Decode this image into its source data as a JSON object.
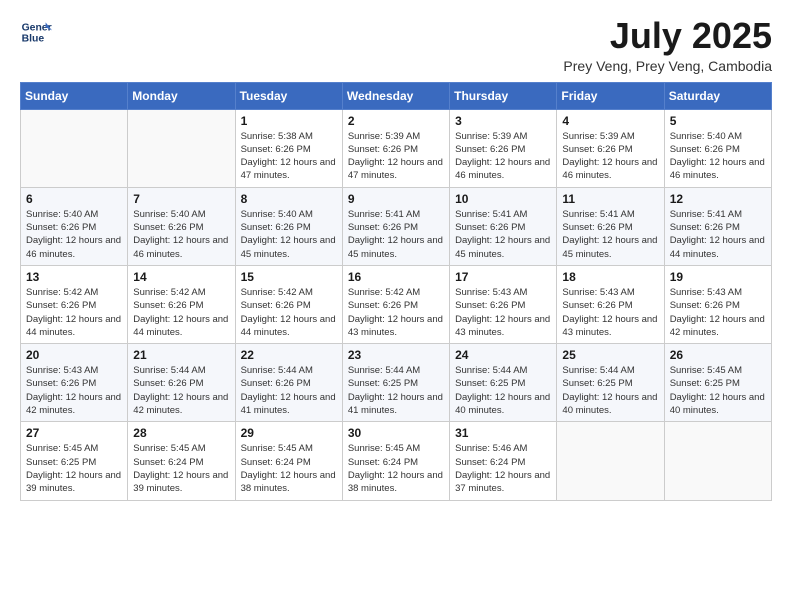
{
  "logo": {
    "line1": "General",
    "line2": "Blue"
  },
  "title": "July 2025",
  "location": "Prey Veng, Prey Veng, Cambodia",
  "days_of_week": [
    "Sunday",
    "Monday",
    "Tuesday",
    "Wednesday",
    "Thursday",
    "Friday",
    "Saturday"
  ],
  "weeks": [
    [
      {
        "day": "",
        "info": ""
      },
      {
        "day": "",
        "info": ""
      },
      {
        "day": "1",
        "info": "Sunrise: 5:38 AM\nSunset: 6:26 PM\nDaylight: 12 hours and 47 minutes."
      },
      {
        "day": "2",
        "info": "Sunrise: 5:39 AM\nSunset: 6:26 PM\nDaylight: 12 hours and 47 minutes."
      },
      {
        "day": "3",
        "info": "Sunrise: 5:39 AM\nSunset: 6:26 PM\nDaylight: 12 hours and 46 minutes."
      },
      {
        "day": "4",
        "info": "Sunrise: 5:39 AM\nSunset: 6:26 PM\nDaylight: 12 hours and 46 minutes."
      },
      {
        "day": "5",
        "info": "Sunrise: 5:40 AM\nSunset: 6:26 PM\nDaylight: 12 hours and 46 minutes."
      }
    ],
    [
      {
        "day": "6",
        "info": "Sunrise: 5:40 AM\nSunset: 6:26 PM\nDaylight: 12 hours and 46 minutes."
      },
      {
        "day": "7",
        "info": "Sunrise: 5:40 AM\nSunset: 6:26 PM\nDaylight: 12 hours and 46 minutes."
      },
      {
        "day": "8",
        "info": "Sunrise: 5:40 AM\nSunset: 6:26 PM\nDaylight: 12 hours and 45 minutes."
      },
      {
        "day": "9",
        "info": "Sunrise: 5:41 AM\nSunset: 6:26 PM\nDaylight: 12 hours and 45 minutes."
      },
      {
        "day": "10",
        "info": "Sunrise: 5:41 AM\nSunset: 6:26 PM\nDaylight: 12 hours and 45 minutes."
      },
      {
        "day": "11",
        "info": "Sunrise: 5:41 AM\nSunset: 6:26 PM\nDaylight: 12 hours and 45 minutes."
      },
      {
        "day": "12",
        "info": "Sunrise: 5:41 AM\nSunset: 6:26 PM\nDaylight: 12 hours and 44 minutes."
      }
    ],
    [
      {
        "day": "13",
        "info": "Sunrise: 5:42 AM\nSunset: 6:26 PM\nDaylight: 12 hours and 44 minutes."
      },
      {
        "day": "14",
        "info": "Sunrise: 5:42 AM\nSunset: 6:26 PM\nDaylight: 12 hours and 44 minutes."
      },
      {
        "day": "15",
        "info": "Sunrise: 5:42 AM\nSunset: 6:26 PM\nDaylight: 12 hours and 44 minutes."
      },
      {
        "day": "16",
        "info": "Sunrise: 5:42 AM\nSunset: 6:26 PM\nDaylight: 12 hours and 43 minutes."
      },
      {
        "day": "17",
        "info": "Sunrise: 5:43 AM\nSunset: 6:26 PM\nDaylight: 12 hours and 43 minutes."
      },
      {
        "day": "18",
        "info": "Sunrise: 5:43 AM\nSunset: 6:26 PM\nDaylight: 12 hours and 43 minutes."
      },
      {
        "day": "19",
        "info": "Sunrise: 5:43 AM\nSunset: 6:26 PM\nDaylight: 12 hours and 42 minutes."
      }
    ],
    [
      {
        "day": "20",
        "info": "Sunrise: 5:43 AM\nSunset: 6:26 PM\nDaylight: 12 hours and 42 minutes."
      },
      {
        "day": "21",
        "info": "Sunrise: 5:44 AM\nSunset: 6:26 PM\nDaylight: 12 hours and 42 minutes."
      },
      {
        "day": "22",
        "info": "Sunrise: 5:44 AM\nSunset: 6:26 PM\nDaylight: 12 hours and 41 minutes."
      },
      {
        "day": "23",
        "info": "Sunrise: 5:44 AM\nSunset: 6:25 PM\nDaylight: 12 hours and 41 minutes."
      },
      {
        "day": "24",
        "info": "Sunrise: 5:44 AM\nSunset: 6:25 PM\nDaylight: 12 hours and 40 minutes."
      },
      {
        "day": "25",
        "info": "Sunrise: 5:44 AM\nSunset: 6:25 PM\nDaylight: 12 hours and 40 minutes."
      },
      {
        "day": "26",
        "info": "Sunrise: 5:45 AM\nSunset: 6:25 PM\nDaylight: 12 hours and 40 minutes."
      }
    ],
    [
      {
        "day": "27",
        "info": "Sunrise: 5:45 AM\nSunset: 6:25 PM\nDaylight: 12 hours and 39 minutes."
      },
      {
        "day": "28",
        "info": "Sunrise: 5:45 AM\nSunset: 6:24 PM\nDaylight: 12 hours and 39 minutes."
      },
      {
        "day": "29",
        "info": "Sunrise: 5:45 AM\nSunset: 6:24 PM\nDaylight: 12 hours and 38 minutes."
      },
      {
        "day": "30",
        "info": "Sunrise: 5:45 AM\nSunset: 6:24 PM\nDaylight: 12 hours and 38 minutes."
      },
      {
        "day": "31",
        "info": "Sunrise: 5:46 AM\nSunset: 6:24 PM\nDaylight: 12 hours and 37 minutes."
      },
      {
        "day": "",
        "info": ""
      },
      {
        "day": "",
        "info": ""
      }
    ]
  ]
}
